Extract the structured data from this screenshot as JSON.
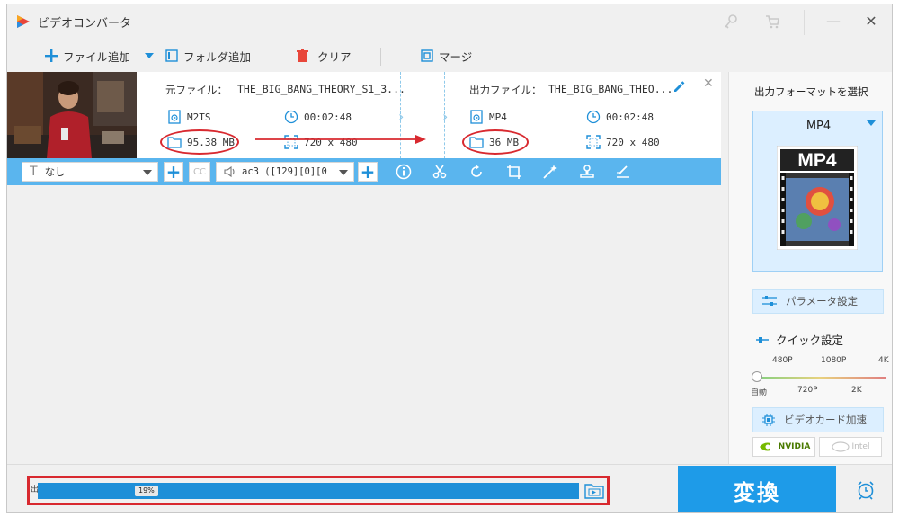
{
  "app": {
    "title": "ビデオコンバータ"
  },
  "toolbar": {
    "add_file": "ファイル追加",
    "add_folder": "フォルダ追加",
    "clear": "クリア",
    "merge": "マージ"
  },
  "source": {
    "label": "元ファイル：",
    "name": "THE_BIG_BANG_THEORY_S1_3...",
    "format": "M2TS",
    "duration": "00:02:48",
    "size": "95.38 MB",
    "resolution": "720 x 480"
  },
  "output": {
    "label": "出力ファイル：",
    "name": "THE_BIG_BANG_THEO...",
    "format": "MP4",
    "duration": "00:02:48",
    "size": "36 MB",
    "resolution": "720 x 480"
  },
  "action_bar": {
    "subtitle_value": "なし",
    "audio_value": "ac3 ([129][0][0",
    "cc_label": "CC"
  },
  "right_panel": {
    "title": "出力フォーマットを選択",
    "format": "MP4",
    "format_badge": "MP4",
    "param_settings": "パラメータ設定",
    "quick_settings": "クイック設定",
    "quality_top": [
      "480P",
      "1080P",
      "4K"
    ],
    "quality_bottom": [
      "自動",
      "720P",
      "2K"
    ],
    "gpu_accel": "ビデオカード加速",
    "nvidia": "NVIDIA",
    "intel": "Intel"
  },
  "progress": {
    "percent": 19,
    "percent_text": "19%",
    "edge_text": "出"
  },
  "convert_button": "変換",
  "colors": {
    "accent": "#1e9be8",
    "annotation": "#d8292f",
    "bar": "#5ab5ee"
  }
}
